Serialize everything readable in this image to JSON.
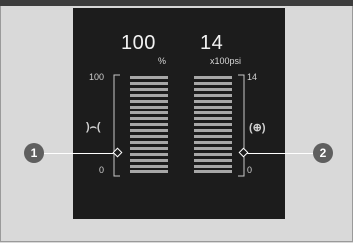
{
  "left_gauge": {
    "value": "100",
    "unit": "%",
    "max_label": "100",
    "min_label": "0",
    "icon": "oil-life-icon",
    "icon_glyph": ")⌢("
  },
  "right_gauge": {
    "value": "14",
    "unit": "x100psi",
    "max_label": "14",
    "min_label": "0",
    "icon": "tire-pressure-icon",
    "icon_glyph": "(⊕)"
  },
  "callouts": [
    {
      "label": "1"
    },
    {
      "label": "2"
    }
  ],
  "colors": {
    "panel": "#1c1c1c",
    "bar": "#a7a7a7",
    "badge": "#5f5f5f",
    "background": "#d9d9d9"
  }
}
